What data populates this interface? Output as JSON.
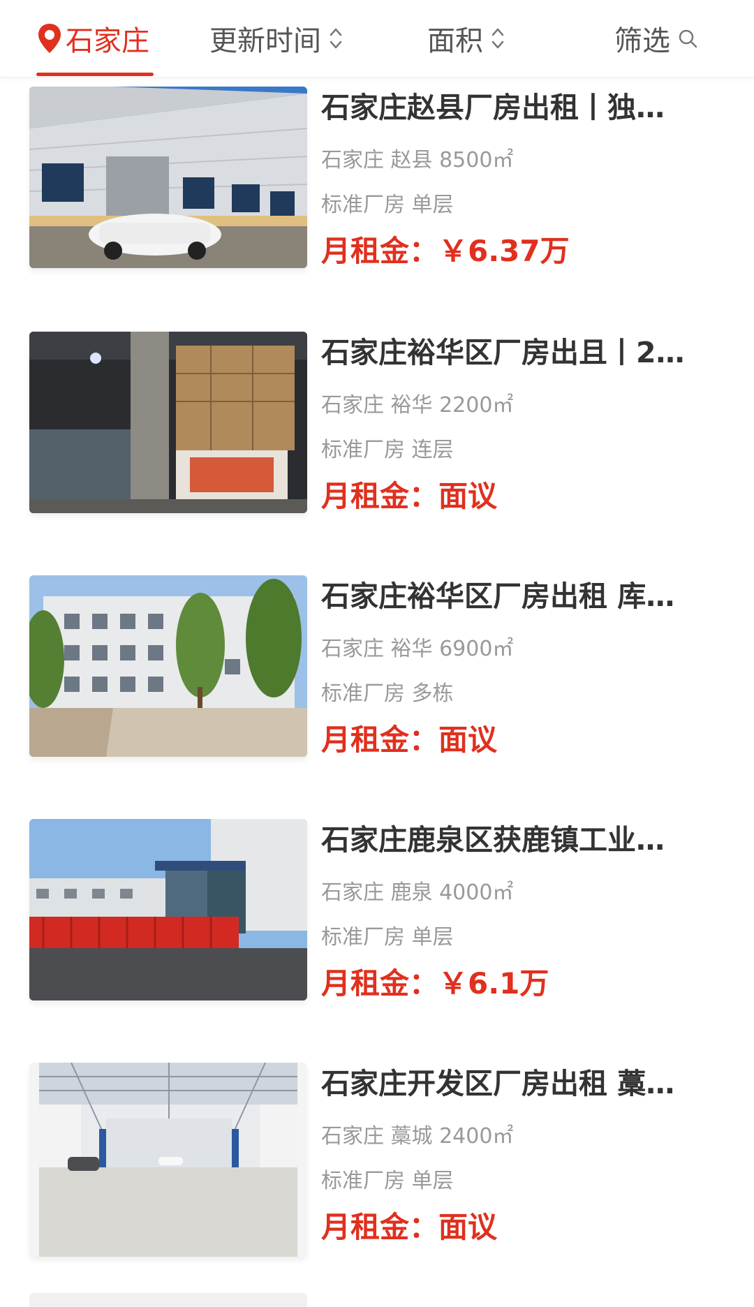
{
  "filters": {
    "city": "石家庄",
    "update_time": "更新时间",
    "area": "面积",
    "filter": "筛选",
    "accent_color": "#e0301e"
  },
  "listings": [
    {
      "title": "石家庄赵县厂房出租丨独…",
      "location": "石家庄 赵县 8500㎡",
      "type": "标准厂房 单层",
      "price": "月租金：￥6.37万"
    },
    {
      "title": "石家庄裕华区厂房出且丨2…",
      "location": "石家庄 裕华 2200㎡",
      "type": "标准厂房 连层",
      "price": "月租金：面议"
    },
    {
      "title": "石家庄裕华区厂房出租 库…",
      "location": "石家庄 裕华 6900㎡",
      "type": "标准厂房 多栋",
      "price": "月租金：面议"
    },
    {
      "title": "石家庄鹿泉区获鹿镇工业…",
      "location": "石家庄 鹿泉 4000㎡",
      "type": "标准厂房 单层",
      "price": "月租金：￥6.1万"
    },
    {
      "title": "石家庄开发区厂房出租 藁…",
      "location": "石家庄 藁城 2400㎡",
      "type": "标准厂房 单层",
      "price": "月租金：面议"
    }
  ]
}
